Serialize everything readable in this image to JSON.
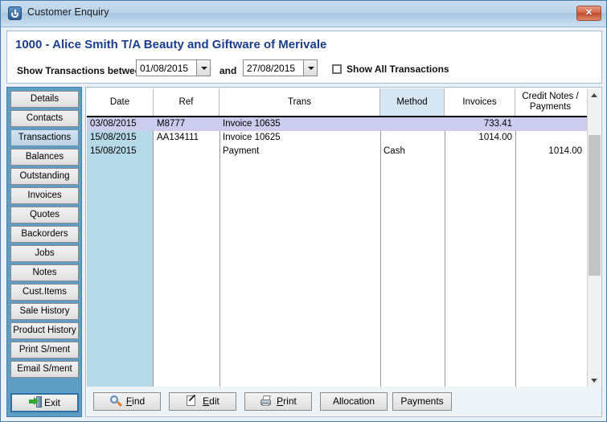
{
  "window": {
    "title": "Customer Enquiry",
    "icon": "power-icon",
    "close_label": "✕"
  },
  "header": {
    "customer_title": "1000 - Alice Smith T/A Beauty and Giftware of Merivale",
    "filter_label": "Show Transactions between",
    "and_label": "and",
    "date_from": "01/08/2015",
    "date_to": "27/08/2015",
    "show_all_label": "Show All Transactions",
    "show_all_checked": false
  },
  "sidebar": {
    "items": [
      {
        "label": "Details",
        "selected": false
      },
      {
        "label": "Contacts",
        "selected": false
      },
      {
        "label": "Transactions",
        "selected": true
      },
      {
        "label": "Balances",
        "selected": false
      },
      {
        "label": "Outstanding",
        "selected": false
      },
      {
        "label": "Invoices",
        "selected": false
      },
      {
        "label": "Quotes",
        "selected": false
      },
      {
        "label": "Backorders",
        "selected": false
      },
      {
        "label": "Jobs",
        "selected": false
      },
      {
        "label": "Notes",
        "selected": false
      },
      {
        "label": "Cust.Items",
        "selected": false
      },
      {
        "label": "Sale History",
        "selected": false
      },
      {
        "label": "Product History",
        "selected": false
      },
      {
        "label": "Print S/ment",
        "selected": false
      },
      {
        "label": "Email S/ment",
        "selected": false
      }
    ],
    "exit_label": "Exit"
  },
  "grid": {
    "columns": [
      {
        "label": "Date",
        "tinted": false
      },
      {
        "label": "Ref",
        "tinted": false
      },
      {
        "label": "Trans",
        "tinted": false
      },
      {
        "label": "Method",
        "tinted": true
      },
      {
        "label": "Invoices",
        "tinted": false
      },
      {
        "label": "Credit Notes / Payments",
        "tinted": false
      }
    ],
    "rows": [
      {
        "date": "03/08/2015",
        "ref": "M8777",
        "trans": "Invoice 10635",
        "method": "",
        "invoices": "733.41",
        "credit_payments": "",
        "selected": true
      },
      {
        "date": "15/08/2015",
        "ref": "AA134111",
        "trans": "Invoice 10625",
        "method": "",
        "invoices": "1014.00",
        "credit_payments": "",
        "selected": false
      },
      {
        "date": "15/08/2015",
        "ref": "",
        "trans": "Payment",
        "method": "Cash",
        "invoices": "",
        "credit_payments": "1014.00",
        "selected": false
      }
    ]
  },
  "toolbar": {
    "find_label": "ind",
    "find_mnemonic": "F",
    "edit_label": "dit",
    "edit_mnemonic": "E",
    "print_label": "rint",
    "print_mnemonic": "P",
    "allocation_label": "Allocation",
    "payments_label": "Payments"
  }
}
